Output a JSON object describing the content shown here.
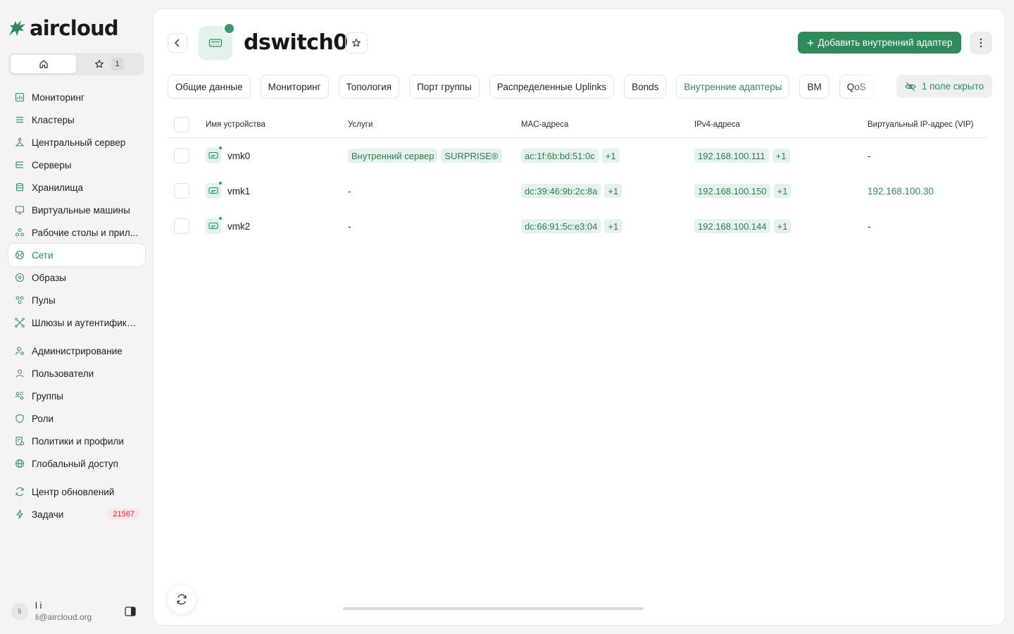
{
  "brand": {
    "name": "aircloud",
    "accent": "#2e8b5a"
  },
  "home_switch": {
    "favorites_count": "1"
  },
  "sidebar": {
    "items": [
      {
        "label": "Мониторинг",
        "icon": "chart-icon"
      },
      {
        "label": "Кластеры",
        "icon": "layers-icon"
      },
      {
        "label": "Центральный сервер",
        "icon": "hierarchy-icon"
      },
      {
        "label": "Серверы",
        "icon": "server-icon"
      },
      {
        "label": "Хранилища",
        "icon": "database-icon"
      },
      {
        "label": "Виртуальные машины",
        "icon": "monitor-icon"
      },
      {
        "label": "Рабочие столы и прил...",
        "icon": "apps-icon"
      },
      {
        "label": "Сети",
        "icon": "network-icon",
        "active": true
      },
      {
        "label": "Образы",
        "icon": "disc-icon"
      },
      {
        "label": "Пулы",
        "icon": "pool-icon"
      },
      {
        "label": "Шлюзы и аутентифика...",
        "icon": "gateway-icon"
      },
      {
        "label": "Администрирование",
        "icon": "admin-icon"
      },
      {
        "label": "Пользователи",
        "icon": "user-icon"
      },
      {
        "label": "Группы",
        "icon": "group-icon"
      },
      {
        "label": "Роли",
        "icon": "shield-icon"
      },
      {
        "label": "Политики и профили",
        "icon": "policy-icon"
      },
      {
        "label": "Глобальный доступ",
        "icon": "globe-icon"
      },
      {
        "label": "Центр обновлений",
        "icon": "refresh-icon"
      },
      {
        "label": "Задачи",
        "icon": "bolt-icon",
        "badge": "21567"
      }
    ]
  },
  "user": {
    "initials": "li",
    "name": "l i",
    "email": "li@aircloud.org"
  },
  "header": {
    "title": "dswitch0",
    "add_button": "Добавить внутренний адаптер",
    "status": "online"
  },
  "tabs": [
    {
      "label": "Общие данные"
    },
    {
      "label": "Мониторинг"
    },
    {
      "label": "Топология"
    },
    {
      "label": "Порт группы"
    },
    {
      "label": "Распределенные Uplinks"
    },
    {
      "label": "Bonds"
    },
    {
      "label": "Внутренние адаптеры",
      "active": true
    },
    {
      "label": "ВМ"
    },
    {
      "label": "QoS"
    }
  ],
  "hidden_fields_label": "1 поле скрыто",
  "table": {
    "columns": [
      "Имя устройства",
      "Услуги",
      "MAC-адреса",
      "IPv4-адреса",
      "Виртуальный IP-адрес (VIP)"
    ],
    "rows": [
      {
        "name": "vmk0",
        "services": [
          "Внутренний сервер",
          "SURPRISE®"
        ],
        "mac": "ac:1f:6b:bd:51:0c",
        "mac_more": "+1",
        "ip": "192.168.100.111",
        "ip_more": "+1",
        "vip": "-"
      },
      {
        "name": "vmk1",
        "services": "-",
        "mac": "dc:39:46:9b:2c:8a",
        "mac_more": "+1",
        "ip": "192.168.100.150",
        "ip_more": "+1",
        "vip": "192.168.100.30"
      },
      {
        "name": "vmk2",
        "services": "-",
        "mac": "dc:66:91:5c:e3:04",
        "mac_more": "+1",
        "ip": "192.168.100.144",
        "ip_more": "+1",
        "vip": "-"
      }
    ]
  }
}
